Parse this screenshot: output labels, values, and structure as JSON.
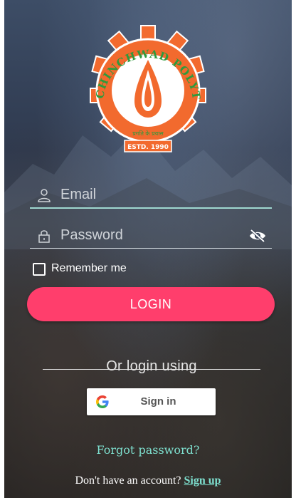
{
  "logo": {
    "ring_text": "PIMPRI CHINCHWAD POLYTECHNIC",
    "motto": "प्रगति के प्रयास",
    "estd": "ESTD. 1990"
  },
  "login_form": {
    "email_placeholder": "Email",
    "password_placeholder": "Password",
    "remember_label": "Remember me",
    "login_button": "LOGIN"
  },
  "social": {
    "or_text": "Or login using",
    "google_label": "Sign in"
  },
  "footer": {
    "forgot_link": "Forgot password?",
    "no_account_text": "Don't have an account? ",
    "signup_link": "Sign up"
  },
  "colors": {
    "accent_button": "#ff3e6c",
    "link": "#7ee0cf",
    "logo_orange": "#f26a2e"
  },
  "icons": {
    "email_field": "user-icon",
    "password_field": "lock-icon",
    "password_toggle": "eye-off-icon",
    "google": "google-g-icon"
  }
}
